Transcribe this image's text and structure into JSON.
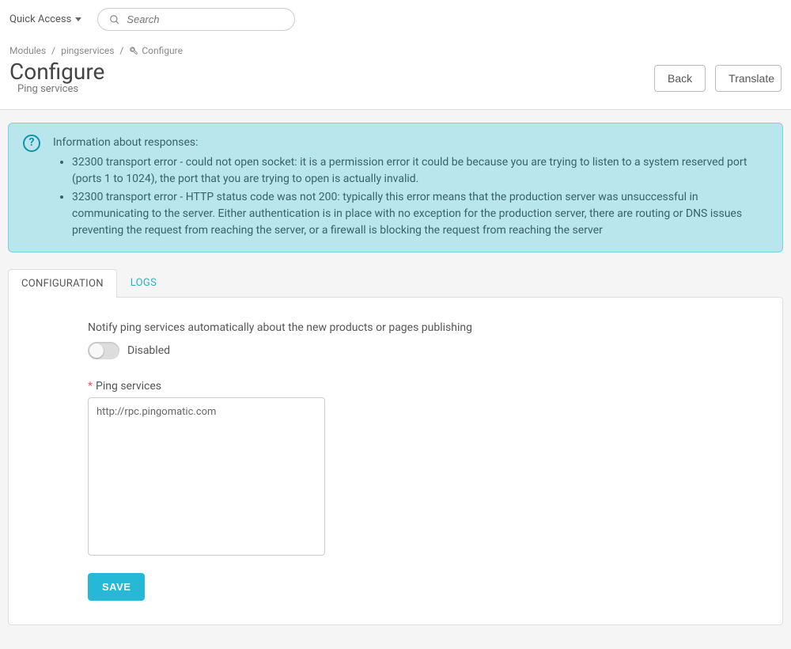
{
  "topbar": {
    "quick_access": "Quick Access",
    "search_placeholder": "Search"
  },
  "breadcrumb": {
    "items": [
      "Modules",
      "pingservices",
      "Configure"
    ]
  },
  "header": {
    "title": "Configure",
    "subtitle": "Ping services",
    "back": "Back",
    "translate": "Translate"
  },
  "infobox": {
    "title": "Information about responses:",
    "items": [
      "32300 transport error - could not open socket: it is a permission error it could be because you are trying to listen to a system reserved port (ports 1 to 1024), the port that you are trying to open is actually invalid.",
      "32300 transport error - HTTP status code was not 200: typically this error means that the production server was unsuccessful in communicating to the server. Either authentication is in place with no exception for the production server, there are routing or DNS issues preventing the request from reaching the server, or a firewall is blocking the request from reaching the server"
    ]
  },
  "tabs": {
    "configuration": "CONFIGURATION",
    "logs": "LOGS"
  },
  "form": {
    "lead": "Notify ping services automatically about the new products or pages publishing",
    "toggle_state": "Disabled",
    "ping_label": "Ping services",
    "ping_value": "http://rpc.pingomatic.com",
    "save": "SAVE"
  }
}
